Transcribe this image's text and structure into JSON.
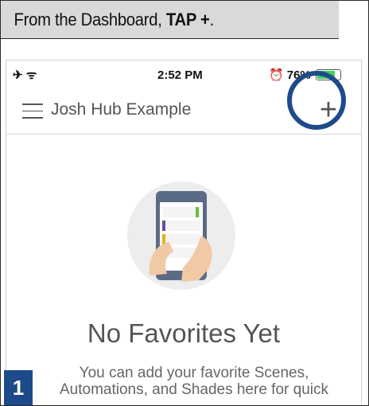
{
  "instruction": {
    "prefix": "From the Dashboard, ",
    "emphasis": "TAP +",
    "suffix": "."
  },
  "status_bar": {
    "time": "2:52 PM",
    "battery_percent": "76%",
    "battery_color": "#3fd15a"
  },
  "nav": {
    "hub_name": "Josh Hub Example",
    "add_label": "+"
  },
  "empty_state": {
    "title": "No Favorites Yet",
    "description_line1": "You can add your favorite Scenes,",
    "description_line2": "Automations, and Shades here for quick"
  },
  "step": {
    "number": "1"
  },
  "colors": {
    "highlight_ring": "#1d4b8a",
    "instruction_bg": "#d9d9d9"
  }
}
